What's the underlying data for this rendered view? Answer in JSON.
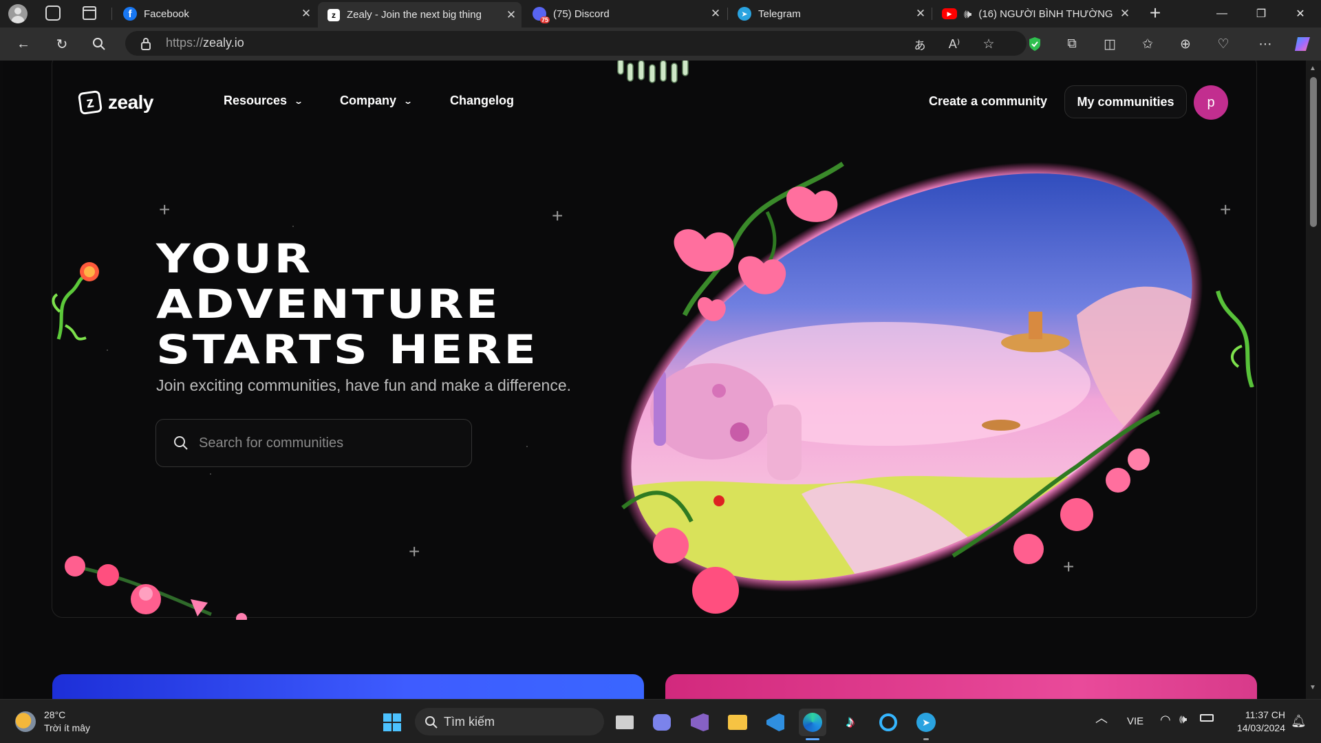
{
  "browser": {
    "tabs": [
      {
        "title": "Facebook",
        "icon": "facebook-icon",
        "active": false
      },
      {
        "title": "Zealy - Join the next big thing",
        "icon": "zealy-icon",
        "active": true
      },
      {
        "title": "(75) Discord",
        "icon": "discord-icon",
        "badge": "75",
        "active": false
      },
      {
        "title": "Telegram",
        "icon": "telegram-icon",
        "active": false
      },
      {
        "title": "(16) NGƯỜI BÌNH THƯỜNG",
        "icon": "youtube-icon",
        "active": false
      }
    ],
    "url_scheme": "https://",
    "url_host": "zealy.io"
  },
  "nav": {
    "logo_text": "zealy",
    "resources_label": "Resources",
    "company_label": "Company",
    "changelog_label": "Changelog",
    "create_label": "Create a community",
    "my_communities_label": "My communities",
    "avatar_letter": "p"
  },
  "hero": {
    "title_line1": "YOUR",
    "title_line2": "ADVENTURE",
    "title_line3": "STARTS HERE",
    "subtitle": "Join exciting communities, have fun and make a difference.",
    "search_placeholder": "Search for communities"
  },
  "taskbar": {
    "weather_temp": "28°C",
    "weather_desc": "Trời ít mây",
    "search_label": "Tìm kiếm",
    "language": "VIE",
    "time": "11:37 CH",
    "date": "14/03/2024"
  },
  "colors": {
    "accent_avatar": "#c22e8f",
    "page_bg": "#0a0a0b",
    "card_blue": "#2a44ff",
    "card_pink": "#e0408f"
  }
}
